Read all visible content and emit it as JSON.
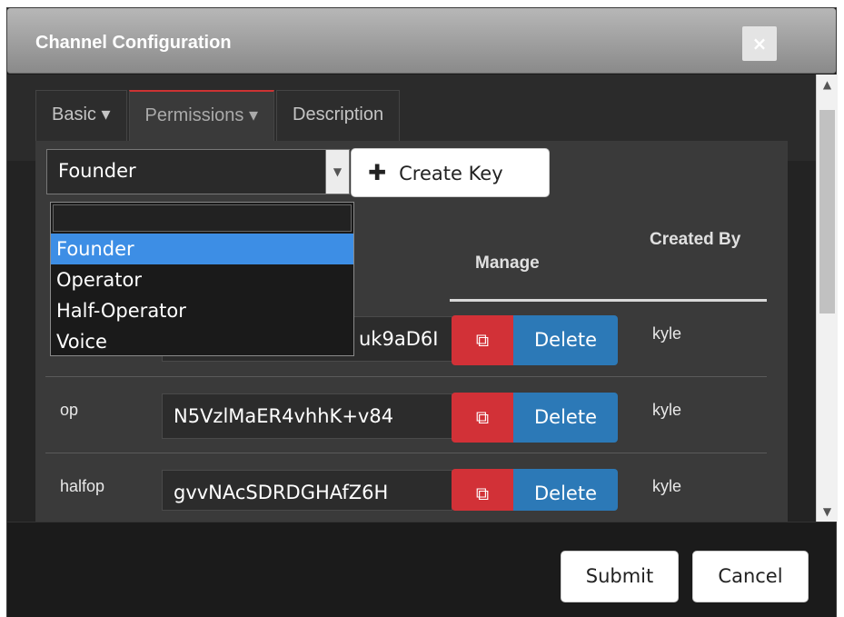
{
  "dialog": {
    "title": "Channel Configuration",
    "close_label": "×"
  },
  "tabs": [
    {
      "label": "Basic ▾"
    },
    {
      "label": "Permissions ▾"
    },
    {
      "label": "Description"
    }
  ],
  "select": {
    "value": "Founder",
    "options": [
      "",
      "Founder",
      "Operator",
      "Half-Operator",
      "Voice"
    ],
    "selected_index": 1
  },
  "create_key": {
    "label": "Create Key"
  },
  "table": {
    "headers": {
      "manage": "Manage",
      "created_by": "Created By"
    },
    "rows": [
      {
        "name": "",
        "key": "uk9aD6I",
        "delete_label": "Delete",
        "created_by": "kyle"
      },
      {
        "name": "op",
        "key": "N5VzlMaER4vhhK+v84",
        "delete_label": "Delete",
        "created_by": "kyle"
      },
      {
        "name": "halfop",
        "key": "gvvNAcSDRDGHAfZ6H",
        "delete_label": "Delete",
        "created_by": "kyle"
      }
    ]
  },
  "footer": {
    "submit_label": "Submit",
    "cancel_label": "Cancel"
  },
  "colors": {
    "accent_red": "#d23137",
    "accent_blue": "#2c79b7",
    "selected_blue": "#3d8ee5"
  }
}
